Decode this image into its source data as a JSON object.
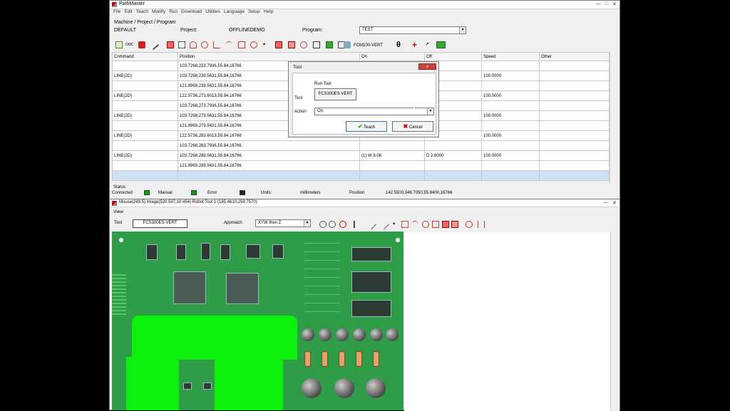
{
  "main_window": {
    "title": "PathMaster",
    "menu": [
      "File",
      "Edit",
      "Teach",
      "Modify",
      "Run",
      "Download",
      "Utilities",
      "Language",
      "Setup",
      "Help"
    ],
    "section_label": "Machine / Project / Program",
    "machine": "DEFAULT",
    "project_label": "Project:",
    "project": "OFFLINEDEMO",
    "program_label": "Program:",
    "program": "TEST",
    "toolbar_tool": "FCM100-VERT",
    "columns": [
      "Command",
      "Position",
      "On",
      "Off",
      "Speed",
      "Other"
    ],
    "rows": [
      {
        "command": "",
        "position": "103.7268,233.7936,55.84,16766",
        "on": "",
        "off": "",
        "speed": ""
      },
      {
        "command": "LINE(2D)",
        "position": "103.7268,239.5631,55.84,16766",
        "on": "",
        "off": "",
        "speed": "100.0000"
      },
      {
        "command": "",
        "position": "121.9969,239.5631,55.84,16766",
        "on": "",
        "off": "",
        "speed": ""
      },
      {
        "command": "LINE(2D)",
        "position": "122.5736,273.6013,55.84,16766",
        "on": "",
        "off": "",
        "speed": "100.0000"
      },
      {
        "command": "",
        "position": "103.7268,273.7936,55.84,16766",
        "on": "",
        "off": "",
        "speed": ""
      },
      {
        "command": "LINE(2D)",
        "position": "103.7268,279.5631,55.84,16766",
        "on": "",
        "off": "",
        "speed": "100.0000"
      },
      {
        "command": "",
        "position": "121.9969,279.5631,55.84,16766",
        "on": "",
        "off": "",
        "speed": ""
      },
      {
        "command": "LINE(2D)",
        "position": "122.5736,283.6013,55.84,16766",
        "on": "",
        "off": "",
        "speed": "100.0000"
      },
      {
        "command": "",
        "position": "103.7268,283.7936,55.84,16766",
        "on": "",
        "off": "",
        "speed": ""
      },
      {
        "command": "LINE(2D)",
        "position": "103.7268,289.5631,55.84,16766",
        "on": "(1) W 8.08",
        "off": "D 2.8000",
        "speed": "100.0000"
      },
      {
        "command": "",
        "position": "121.9969,289.5631,55.84,16766",
        "on": "",
        "off": "",
        "speed": ""
      }
    ],
    "status": {
      "label": "Status",
      "connected": "Connected",
      "manual": "Manual",
      "error": "Error",
      "units_label": "Units:",
      "units": "millimeters",
      "position_label": "Position",
      "position": "142.5500,346.7050,55.8400,16766"
    }
  },
  "dialog": {
    "title": "Tool",
    "close": "x",
    "run_tool_label": "Run Tool",
    "tool_label": "Tool",
    "tool_button": "FCS300ES-VERT",
    "action_label": "Action",
    "action_value": "On",
    "teach_button": "Teach",
    "cancel_button": "Cancel"
  },
  "image_window": {
    "title": "Mouse(249,5) Image(520.597,10.454) Robot Tool 1 (185.4610,259.7570)",
    "menu_view": "View",
    "tool_label": "Tool",
    "tool_value": "FCS300ES-VERT",
    "approach_label": "Approach",
    "approach_value": "XYW then Z"
  },
  "colors": {
    "highlight_green": "#0df20d",
    "pcb_green": "#2f9d48",
    "selected_row": "#cfe0f4"
  }
}
